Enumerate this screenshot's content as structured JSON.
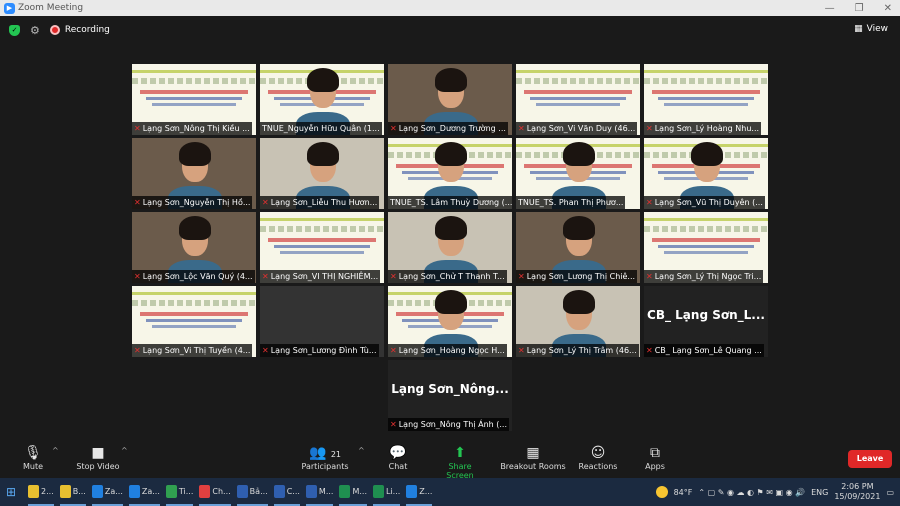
{
  "window": {
    "title": "Zoom Meeting"
  },
  "topbar": {
    "recording_label": "Recording",
    "view_label": "View"
  },
  "tiles": [
    {
      "name": "Lạng Sơn_Nông Thị Kiều ...",
      "kind": "slide",
      "muted": true
    },
    {
      "name": "TNUE_Nguyễn Hữu Quân (1...",
      "kind": "slide",
      "muted": false
    },
    {
      "name": "Lạng Sơn_Dương Trường ...",
      "kind": "cam",
      "muted": true
    },
    {
      "name": "Lạng Sơn_Vi Văn Duy (46...",
      "kind": "slide",
      "muted": true
    },
    {
      "name": "Lạng Sơn_Lý Hoàng Nhu...",
      "kind": "slide",
      "muted": true
    },
    {
      "name": "Lạng Sơn_Nguyễn Thị Hồ...",
      "kind": "cam",
      "muted": true
    },
    {
      "name": "Lạng Sơn_Liễu Thu Hươn...",
      "kind": "cam",
      "muted": true
    },
    {
      "name": "TNUE_TS. Lâm Thuỳ Dương (...",
      "kind": "slide",
      "muted": false
    },
    {
      "name": "TNUE_TS. Phan Thị Phươ...",
      "kind": "slide",
      "muted": false
    },
    {
      "name": "Lạng Sơn_Vũ Thị Duyên (...",
      "kind": "slide",
      "muted": true
    },
    {
      "name": "Lạng Sơn_Lộc Văn Quý (4...",
      "kind": "cam",
      "muted": true
    },
    {
      "name": "Lạng Sơn_VI THỊ NGHIÊM...",
      "kind": "slide",
      "muted": true
    },
    {
      "name": "Lạng Sơn_Chử T Thanh T...",
      "kind": "cam",
      "muted": true
    },
    {
      "name": "Lạng Sơn_Lương Thị Chiê...",
      "kind": "cam",
      "muted": true
    },
    {
      "name": "Lạng Sơn_Lý Thị Ngọc Tri...",
      "kind": "slide",
      "muted": true
    },
    {
      "name": "Lạng Sơn_Vi Thị Tuyền (4...",
      "kind": "slide",
      "muted": true
    },
    {
      "name": "Lạng Sơn_Lương Đình Tù...",
      "kind": "blank",
      "muted": true
    },
    {
      "name": "Lạng Sơn_Hoàng Ngọc H...",
      "kind": "slide",
      "muted": true
    },
    {
      "name": "Lạng Sơn_Lý Thị Trâm (46...",
      "kind": "cam",
      "muted": true
    },
    {
      "name": "CB_ Lạng Sơn_Lê Quang ...",
      "kind": "text",
      "muted": true,
      "big": "CB_ Lạng Sơn_L..."
    },
    {
      "name": "Lạng Sơn_Nông Thị Ánh (...",
      "kind": "text",
      "muted": true,
      "big": "Lạng Sơn_Nông..."
    }
  ],
  "toolbar": {
    "mute": "Mute",
    "stop_video": "Stop Video",
    "participants": "Participants",
    "participants_count": "21",
    "chat": "Chat",
    "share": "Share Screen",
    "breakout": "Breakout Rooms",
    "reactions": "Reactions",
    "apps": "Apps",
    "leave": "Leave"
  },
  "taskbar": {
    "items": [
      "2...",
      "B...",
      "Za...",
      "Za...",
      "Ti...",
      "Ch...",
      "Bả...",
      "C...",
      "M...",
      "M...",
      "Li...",
      "Z..."
    ],
    "weather": "84°F",
    "lang": "ENG",
    "time": "2:06 PM",
    "date": "15/09/2021"
  }
}
